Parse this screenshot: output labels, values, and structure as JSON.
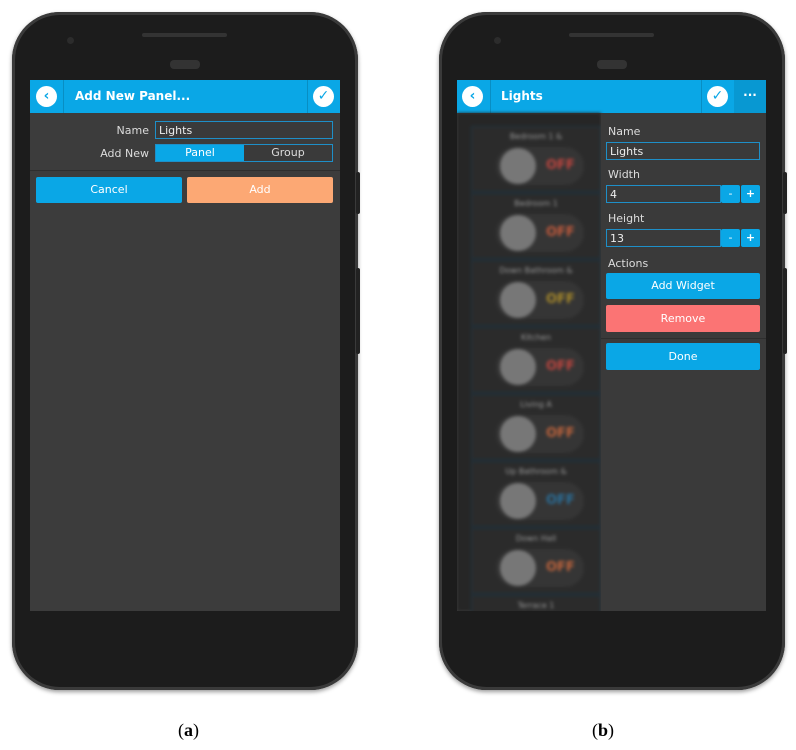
{
  "panel_a": {
    "header": {
      "title": "Add New Panel...",
      "back_icon": "chevron-left-icon",
      "confirm_icon": "check-icon"
    },
    "name_label": "Name",
    "name_value": "Lights",
    "add_new_label": "Add New",
    "segments": [
      {
        "label": "Panel",
        "selected": true
      },
      {
        "label": "Group",
        "selected": false
      }
    ],
    "cancel_label": "Cancel",
    "add_label": "Add",
    "colors": {
      "accent": "#0aa7e6",
      "add": "#fca874"
    }
  },
  "panel_b": {
    "header": {
      "title": "Lights",
      "back_icon": "chevron-left-icon",
      "confirm_icon": "check-icon",
      "more_icon": "ellipsis-icon"
    },
    "name_label": "Name",
    "name_value": "Lights",
    "width_label": "Width",
    "width_value": "4",
    "height_label": "Height",
    "height_value": "13",
    "minus": "-",
    "plus": "+",
    "actions_label": "Actions",
    "add_widget_label": "Add Widget",
    "remove_label": "Remove",
    "done_label": "Done",
    "colors": {
      "remove": "#fb7474"
    },
    "widgets": [
      {
        "name": "Bedroom 1 &",
        "state": "OFF",
        "color": "#c0453f"
      },
      {
        "name": "Bedroom 1",
        "state": "OFF",
        "color": "#c25a3c"
      },
      {
        "name": "Down Bathroom &",
        "state": "OFF",
        "color": "#a88a2a"
      },
      {
        "name": "Kitchen",
        "state": "OFF",
        "color": "#c0453f"
      },
      {
        "name": "Living A",
        "state": "OFF",
        "color": "#c0643c"
      },
      {
        "name": "Up Bathroom &",
        "state": "OFF",
        "color": "#2a6f9a"
      },
      {
        "name": "Down Hall",
        "state": "OFF",
        "color": "#c0643c"
      },
      {
        "name": "Terrace 1",
        "state": "OFF",
        "color": "#c0453f"
      }
    ]
  },
  "captions": {
    "a": "a",
    "b": "b"
  }
}
